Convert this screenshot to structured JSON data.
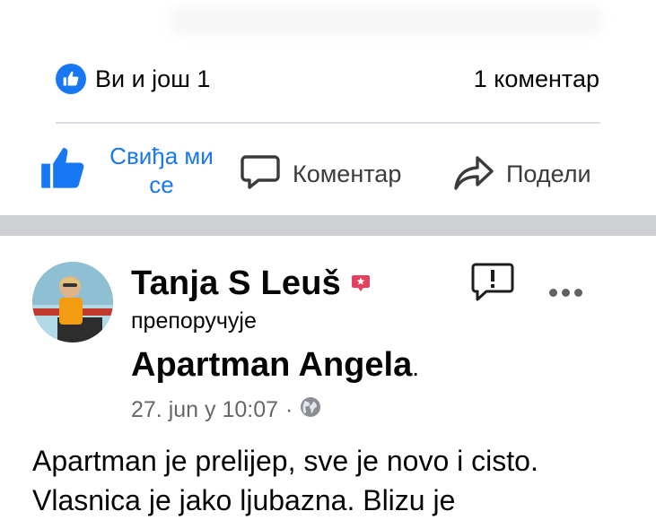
{
  "reactions": {
    "summary": "Ви и још 1",
    "comments": "1 коментар"
  },
  "actions": {
    "like_line1": "Свиђа ми",
    "like_line2": "се",
    "comment": "Коментар",
    "share": "Подели"
  },
  "post": {
    "author": "Tanja S Leuš",
    "action_text": "препоручује",
    "page": "Apartman Angela",
    "page_suffix": ".",
    "date": "27. jun у 10:07",
    "separator": "·",
    "body": "Apartman je prelijep, sve je novo i cisto. Vlasnica je jako ljubazna. Blizu je"
  },
  "colors": {
    "facebook_blue": "#1877f2",
    "recommend_badge": "#e4405f",
    "divider": "#dadde1",
    "secondary_text": "#65676b"
  },
  "icons": [
    "like-reaction-icon",
    "thumbs-up-icon",
    "comment-bubble-icon",
    "share-arrow-icon",
    "recommend-badge-icon",
    "report-icon",
    "more-options-icon",
    "globe-icon"
  ]
}
